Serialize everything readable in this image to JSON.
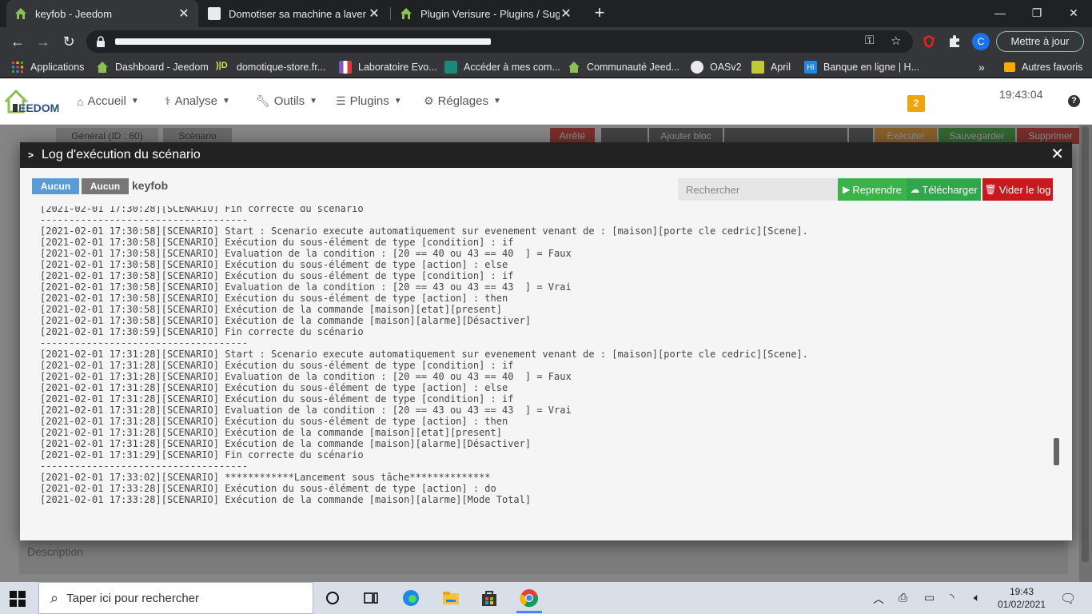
{
  "browser": {
    "tabs": [
      {
        "title": "keyfob - Jeedom",
        "active": true
      },
      {
        "title": "Domotiser sa machine a laver via",
        "active": false
      },
      {
        "title": "Plugin Verisure - Plugins / Sugge",
        "active": false
      }
    ],
    "update_label": "Mettre à jour",
    "profile_initial": "C",
    "bookmarks": [
      "Applications",
      "Dashboard - Jeedom",
      "domotique-store.fr...",
      "Laboratoire Evo...",
      "Accéder à mes com...",
      "Communauté Jeed...",
      "OASv2",
      "April",
      "Banque en ligne | H...",
      "Autres favoris"
    ]
  },
  "jeedom": {
    "menu": [
      {
        "label": "Accueil",
        "icon": "home-icon"
      },
      {
        "label": "Analyse",
        "icon": "stethoscope-icon"
      },
      {
        "label": "Outils",
        "icon": "wrench-icon"
      },
      {
        "label": "Plugins",
        "icon": "tasks-icon"
      },
      {
        "label": "Réglages",
        "icon": "cogs-icon"
      }
    ],
    "message_count": "2",
    "clock": "19:43:04",
    "behind": {
      "tab_general": "Général (ID : 60)",
      "tab_scenario": "Scénario",
      "arrete": "Arrêté",
      "ajouter_bloc": "Ajouter bloc",
      "executer": "Exécuter",
      "sauvegarder": "Sauvegarder",
      "supprimer": "Supprimer"
    },
    "description_placeholder": "Description"
  },
  "modal": {
    "title": "Log d'exécution du scénario",
    "btn_aucun_1": "Aucun",
    "btn_aucun_2": "Aucun",
    "label": "keyfob",
    "search_placeholder": "Rechercher",
    "btn_reprendre": "Reprendre",
    "btn_telecharger": "Télécharger",
    "btn_vider": "Vider le log",
    "log_lines": [
      "[2021-02-01 17:30:28][SCENARIO] Fin correcte du scénario",
      "------------------------------------",
      "[2021-02-01 17:30:58][SCENARIO] Start : Scenario execute automatiquement sur evenement venant de : [maison][porte cle cedric][Scene].",
      "[2021-02-01 17:30:58][SCENARIO] Exécution du sous-élément de type [condition] : if",
      "[2021-02-01 17:30:58][SCENARIO] Evaluation de la condition : [20 == 40 ou 43 == 40  ] = Faux",
      "[2021-02-01 17:30:58][SCENARIO] Exécution du sous-élément de type [action] : else",
      "[2021-02-01 17:30:58][SCENARIO] Exécution du sous-élément de type [condition] : if",
      "[2021-02-01 17:30:58][SCENARIO] Evaluation de la condition : [20 == 43 ou 43 == 43  ] = Vrai",
      "[2021-02-01 17:30:58][SCENARIO] Exécution du sous-élément de type [action] : then",
      "[2021-02-01 17:30:58][SCENARIO] Exécution de la commande [maison][etat][present]",
      "[2021-02-01 17:30:58][SCENARIO] Exécution de la commande [maison][alarme][Désactiver]",
      "[2021-02-01 17:30:59][SCENARIO] Fin correcte du scénario",
      "------------------------------------",
      "[2021-02-01 17:31:28][SCENARIO] Start : Scenario execute automatiquement sur evenement venant de : [maison][porte cle cedric][Scene].",
      "[2021-02-01 17:31:28][SCENARIO] Exécution du sous-élément de type [condition] : if",
      "[2021-02-01 17:31:28][SCENARIO] Evaluation de la condition : [20 == 40 ou 43 == 40  ] = Faux",
      "[2021-02-01 17:31:28][SCENARIO] Exécution du sous-élément de type [action] : else",
      "[2021-02-01 17:31:28][SCENARIO] Exécution du sous-élément de type [condition] : if",
      "[2021-02-01 17:31:28][SCENARIO] Evaluation de la condition : [20 == 43 ou 43 == 43  ] = Vrai",
      "[2021-02-01 17:31:28][SCENARIO] Exécution du sous-élément de type [action] : then",
      "[2021-02-01 17:31:28][SCENARIO] Exécution de la commande [maison][etat][present]",
      "[2021-02-01 17:31:28][SCENARIO] Exécution de la commande [maison][alarme][Désactiver]",
      "[2021-02-01 17:31:29][SCENARIO] Fin correcte du scénario",
      "------------------------------------",
      "[2021-02-01 17:33:02][SCENARIO] ************Lancement sous tâche**************",
      "[2021-02-01 17:33:28][SCENARIO] Exécution du sous-élément de type [action] : do",
      "[2021-02-01 17:33:28][SCENARIO] Exécution de la commande [maison][alarme][Mode Total]"
    ]
  },
  "taskbar": {
    "search_placeholder": "Taper ici pour rechercher",
    "time": "19:43",
    "date": "01/02/2021"
  },
  "colors": {
    "aucun_blue": "#5b9bd5",
    "reprendre_green": "#3cb34a",
    "telecharger_green": "#2ea84a",
    "vider_red": "#c9181e",
    "badge_orange": "#f0a30a"
  }
}
